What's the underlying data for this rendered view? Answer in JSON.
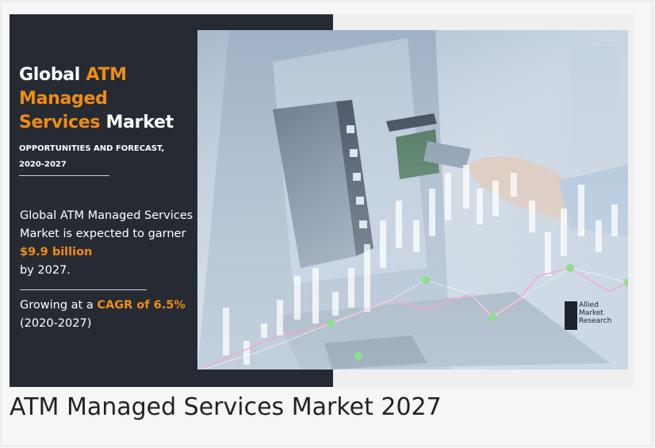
{
  "infographic": {
    "title": {
      "line1_plain": "Global ",
      "line1_accent": "ATM",
      "line2_accent": "Managed",
      "line3_accent": "Services",
      "line3_plain": " Market"
    },
    "subtitle_line1": "OPPORTUNITIES AND FORECAST,",
    "subtitle_line2": "2020-2027",
    "body": {
      "intro": "Global ATM Managed Services Market is expected to garner ",
      "value": "$9.9 billion",
      "outro": "by 2027."
    },
    "growth": {
      "prefix": "Growing at a ",
      "cagr": "CAGR of 6.5%",
      "period": "(2020-2027)"
    },
    "brand": {
      "line1": "Allied",
      "line2": "Market",
      "line3": "Research"
    },
    "colors": {
      "panel": "#262b33",
      "accent": "#f08c12"
    }
  },
  "caption": "ATM Managed Services Market 2027"
}
